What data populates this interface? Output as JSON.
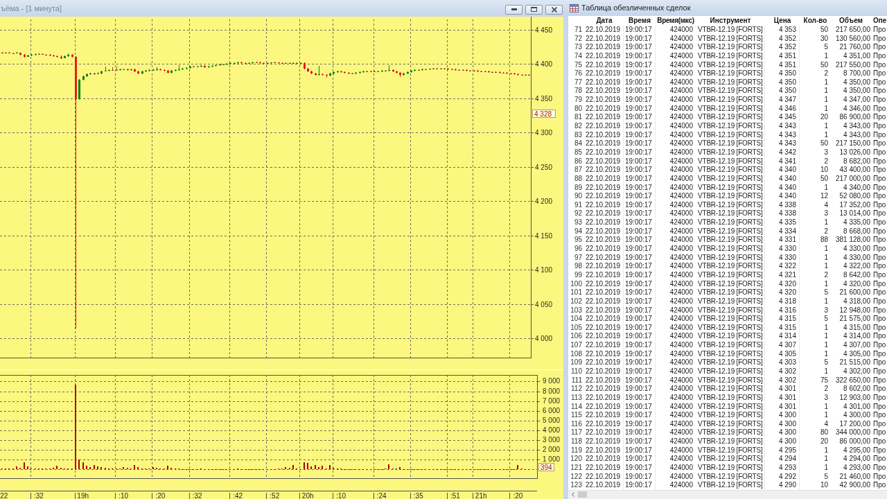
{
  "chart_window": {
    "title": "ъёма - [1 минута]",
    "price_chart": {
      "axis_labels": [
        "4 450",
        "4 400",
        "4 350",
        "4 300",
        "4 250",
        "4 200",
        "4 150",
        "4 100",
        "4 050",
        "4 000"
      ],
      "last_price": "4 328"
    },
    "volume_chart": {
      "chart_data": {
        "type": "bar",
        "grid": true,
        "categories": [
          "22",
          null,
          null,
          null,
          null,
          null,
          null,
          null,
          null,
          null,
          ":32",
          null,
          null,
          null,
          null,
          null,
          null,
          null,
          null,
          null,
          null,
          null,
          "19h",
          null,
          null,
          null,
          null,
          null,
          null,
          null,
          null,
          null,
          null,
          ":10",
          null,
          null,
          null,
          null,
          null,
          null,
          null,
          null,
          null,
          ":20",
          null,
          null,
          null,
          null,
          null,
          null,
          null,
          null,
          null,
          ":32",
          null,
          null,
          null,
          null,
          null,
          null,
          null,
          null,
          null,
          null,
          ":42",
          null,
          null,
          null,
          null,
          null,
          null,
          null,
          null,
          null,
          ":52",
          null,
          null,
          null,
          null,
          null,
          null,
          null,
          null,
          "20h",
          null,
          null,
          null,
          null,
          null,
          null,
          null,
          null,
          ":10",
          null,
          null,
          null,
          null,
          null,
          null,
          null,
          null,
          null,
          null,
          ":24",
          null,
          null,
          null,
          null,
          null,
          null,
          null,
          null,
          null,
          ":35",
          null,
          null,
          null,
          null,
          null,
          null,
          null,
          null,
          null,
          ":51",
          null,
          null,
          null,
          null,
          null,
          null,
          "21h",
          null,
          null,
          null,
          null,
          null,
          null,
          null,
          null,
          null,
          ":20",
          null,
          null,
          null
        ],
        "ylim": [
          -889,
          9673
        ],
        "yticks": [
          {
            "value": 9000,
            "label": "9 000"
          },
          {
            "value": 8000,
            "label": "8 000"
          },
          {
            "value": 7000,
            "label": "7 000"
          },
          {
            "value": 6000,
            "label": "6 000"
          },
          {
            "value": 5000,
            "label": "5 000"
          },
          {
            "value": 4000,
            "label": "4 000"
          },
          {
            "value": 3000,
            "label": "3 000"
          },
          {
            "value": 2000,
            "label": "2 000"
          },
          {
            "value": 1000,
            "label": "1 000"
          }
        ],
        "annotations": [
          {
            "text": "394",
            "y": 394
          }
        ],
        "values": [
          80,
          60,
          90,
          70,
          280,
          120,
          680,
          280,
          60,
          50,
          70,
          60,
          80,
          90,
          120,
          360,
          120,
          60,
          50,
          80,
          8700,
          1000,
          680,
          360,
          200,
          400,
          320,
          200,
          120,
          100,
          90,
          80,
          100,
          240,
          120,
          90,
          440,
          240,
          100,
          60,
          80,
          200,
          160,
          80,
          60,
          360,
          160,
          60,
          40,
          30,
          30,
          20,
          30,
          20,
          40,
          20,
          30,
          20,
          20,
          30,
          20,
          30,
          20,
          20,
          40,
          20,
          20,
          30,
          20,
          20,
          20,
          30,
          20,
          20,
          30,
          40,
          60,
          200,
          120,
          400,
          40,
          30,
          720,
          640,
          280,
          440,
          200,
          360,
          80,
          400,
          120,
          60,
          40,
          30,
          20,
          30,
          20,
          20,
          30,
          20,
          20,
          30,
          20,
          20,
          40,
          520,
          60,
          40,
          240,
          30,
          30,
          20,
          20,
          20,
          20,
          20,
          30,
          20,
          20,
          20,
          20,
          20,
          20,
          20,
          30,
          20,
          20,
          20,
          20,
          20,
          20,
          20,
          20,
          20,
          20,
          20,
          20,
          20,
          20,
          20,
          440,
          60,
          30,
          20
        ]
      }
    }
  },
  "trades_window": {
    "title": "Таблица обезличенных сделок",
    "table": {
      "columns": [
        "Дата",
        "Время",
        "Время(мкс)",
        "Инструмент",
        "Цена",
        "Кол-во",
        "Объем",
        "Опе"
      ],
      "rows": [
        {
          "number": "71",
          "cells": [
            "22.10.2019",
            "19:00:17",
            "424000",
            "VTBR-12.19 [FORTS]",
            "4 353",
            "50",
            "217 650,00",
            "Про"
          ]
        },
        {
          "number": "72",
          "cells": [
            "22.10.2019",
            "19:00:17",
            "424000",
            "VTBR-12.19 [FORTS]",
            "4 352",
            "30",
            "130 560,00",
            "Про"
          ]
        },
        {
          "number": "73",
          "cells": [
            "22.10.2019",
            "19:00:17",
            "424000",
            "VTBR-12.19 [FORTS]",
            "4 352",
            "5",
            "21 760,00",
            "Про"
          ]
        },
        {
          "number": "74",
          "cells": [
            "22.10.2019",
            "19:00:17",
            "424000",
            "VTBR-12.19 [FORTS]",
            "4 351",
            "1",
            "4 351,00",
            "Про"
          ]
        },
        {
          "number": "75",
          "cells": [
            "22.10.2019",
            "19:00:17",
            "424000",
            "VTBR-12.19 [FORTS]",
            "4 351",
            "50",
            "217 550,00",
            "Про"
          ]
        },
        {
          "number": "76",
          "cells": [
            "22.10.2019",
            "19:00:17",
            "424000",
            "VTBR-12.19 [FORTS]",
            "4 350",
            "2",
            "8 700,00",
            "Про"
          ]
        },
        {
          "number": "77",
          "cells": [
            "22.10.2019",
            "19:00:17",
            "424000",
            "VTBR-12.19 [FORTS]",
            "4 350",
            "1",
            "4 350,00",
            "Про"
          ]
        },
        {
          "number": "78",
          "cells": [
            "22.10.2019",
            "19:00:17",
            "424000",
            "VTBR-12.19 [FORTS]",
            "4 350",
            "1",
            "4 350,00",
            "Про"
          ]
        },
        {
          "number": "79",
          "cells": [
            "22.10.2019",
            "19:00:17",
            "424000",
            "VTBR-12.19 [FORTS]",
            "4 347",
            "1",
            "4 347,00",
            "Про"
          ]
        },
        {
          "number": "80",
          "cells": [
            "22.10.2019",
            "19:00:17",
            "424000",
            "VTBR-12.19 [FORTS]",
            "4 346",
            "1",
            "4 346,00",
            "Про"
          ]
        },
        {
          "number": "81",
          "cells": [
            "22.10.2019",
            "19:00:17",
            "424000",
            "VTBR-12.19 [FORTS]",
            "4 345",
            "20",
            "86 900,00",
            "Про"
          ]
        },
        {
          "number": "82",
          "cells": [
            "22.10.2019",
            "19:00:17",
            "424000",
            "VTBR-12.19 [FORTS]",
            "4 343",
            "1",
            "4 343,00",
            "Про"
          ]
        },
        {
          "number": "83",
          "cells": [
            "22.10.2019",
            "19:00:17",
            "424000",
            "VTBR-12.19 [FORTS]",
            "4 343",
            "1",
            "4 343,00",
            "Про"
          ]
        },
        {
          "number": "84",
          "cells": [
            "22.10.2019",
            "19:00:17",
            "424000",
            "VTBR-12.19 [FORTS]",
            "4 343",
            "50",
            "217 150,00",
            "Про"
          ]
        },
        {
          "number": "85",
          "cells": [
            "22.10.2019",
            "19:00:17",
            "424000",
            "VTBR-12.19 [FORTS]",
            "4 342",
            "3",
            "13 026,00",
            "Про"
          ]
        },
        {
          "number": "86",
          "cells": [
            "22.10.2019",
            "19:00:17",
            "424000",
            "VTBR-12.19 [FORTS]",
            "4 341",
            "2",
            "8 682,00",
            "Про"
          ]
        },
        {
          "number": "87",
          "cells": [
            "22.10.2019",
            "19:00:17",
            "424000",
            "VTBR-12.19 [FORTS]",
            "4 340",
            "10",
            "43 400,00",
            "Про"
          ]
        },
        {
          "number": "88",
          "cells": [
            "22.10.2019",
            "19:00:17",
            "424000",
            "VTBR-12.19 [FORTS]",
            "4 340",
            "50",
            "217 000,00",
            "Про"
          ]
        },
        {
          "number": "89",
          "cells": [
            "22.10.2019",
            "19:00:17",
            "424000",
            "VTBR-12.19 [FORTS]",
            "4 340",
            "1",
            "4 340,00",
            "Про"
          ]
        },
        {
          "number": "90",
          "cells": [
            "22.10.2019",
            "19:00:17",
            "424000",
            "VTBR-12.19 [FORTS]",
            "4 340",
            "12",
            "52 080,00",
            "Про"
          ]
        },
        {
          "number": "91",
          "cells": [
            "22.10.2019",
            "19:00:17",
            "424000",
            "VTBR-12.19 [FORTS]",
            "4 338",
            "4",
            "17 352,00",
            "Про"
          ]
        },
        {
          "number": "92",
          "cells": [
            "22.10.2019",
            "19:00:17",
            "424000",
            "VTBR-12.19 [FORTS]",
            "4 338",
            "3",
            "13 014,00",
            "Про"
          ]
        },
        {
          "number": "93",
          "cells": [
            "22.10.2019",
            "19:00:17",
            "424000",
            "VTBR-12.19 [FORTS]",
            "4 335",
            "1",
            "4 335,00",
            "Про"
          ]
        },
        {
          "number": "94",
          "cells": [
            "22.10.2019",
            "19:00:17",
            "424000",
            "VTBR-12.19 [FORTS]",
            "4 334",
            "2",
            "8 668,00",
            "Про"
          ]
        },
        {
          "number": "95",
          "cells": [
            "22.10.2019",
            "19:00:17",
            "424000",
            "VTBR-12.19 [FORTS]",
            "4 331",
            "88",
            "381 128,00",
            "Про"
          ]
        },
        {
          "number": "96",
          "cells": [
            "22.10.2019",
            "19:00:17",
            "424000",
            "VTBR-12.19 [FORTS]",
            "4 330",
            "1",
            "4 330,00",
            "Про"
          ]
        },
        {
          "number": "97",
          "cells": [
            "22.10.2019",
            "19:00:17",
            "424000",
            "VTBR-12.19 [FORTS]",
            "4 330",
            "1",
            "4 330,00",
            "Про"
          ]
        },
        {
          "number": "98",
          "cells": [
            "22.10.2019",
            "19:00:17",
            "424000",
            "VTBR-12.19 [FORTS]",
            "4 322",
            "1",
            "4 322,00",
            "Про"
          ]
        },
        {
          "number": "99",
          "cells": [
            "22.10.2019",
            "19:00:17",
            "424000",
            "VTBR-12.19 [FORTS]",
            "4 321",
            "2",
            "8 642,00",
            "Про"
          ]
        },
        {
          "number": "100",
          "cells": [
            "22.10.2019",
            "19:00:17",
            "424000",
            "VTBR-12.19 [FORTS]",
            "4 320",
            "1",
            "4 320,00",
            "Про"
          ]
        },
        {
          "number": "101",
          "cells": [
            "22.10.2019",
            "19:00:17",
            "424000",
            "VTBR-12.19 [FORTS]",
            "4 320",
            "5",
            "21 600,00",
            "Про"
          ]
        },
        {
          "number": "102",
          "cells": [
            "22.10.2019",
            "19:00:17",
            "424000",
            "VTBR-12.19 [FORTS]",
            "4 318",
            "1",
            "4 318,00",
            "Про"
          ]
        },
        {
          "number": "103",
          "cells": [
            "22.10.2019",
            "19:00:17",
            "424000",
            "VTBR-12.19 [FORTS]",
            "4 316",
            "3",
            "12 948,00",
            "Про"
          ]
        },
        {
          "number": "104",
          "cells": [
            "22.10.2019",
            "19:00:17",
            "424000",
            "VTBR-12.19 [FORTS]",
            "4 315",
            "5",
            "21 575,00",
            "Про"
          ]
        },
        {
          "number": "105",
          "cells": [
            "22.10.2019",
            "19:00:17",
            "424000",
            "VTBR-12.19 [FORTS]",
            "4 315",
            "1",
            "4 315,00",
            "Про"
          ]
        },
        {
          "number": "106",
          "cells": [
            "22.10.2019",
            "19:00:17",
            "424000",
            "VTBR-12.19 [FORTS]",
            "4 314",
            "1",
            "4 314,00",
            "Про"
          ]
        },
        {
          "number": "107",
          "cells": [
            "22.10.2019",
            "19:00:17",
            "424000",
            "VTBR-12.19 [FORTS]",
            "4 307",
            "1",
            "4 307,00",
            "Про"
          ]
        },
        {
          "number": "108",
          "cells": [
            "22.10.2019",
            "19:00:17",
            "424000",
            "VTBR-12.19 [FORTS]",
            "4 305",
            "1",
            "4 305,00",
            "Про"
          ]
        },
        {
          "number": "109",
          "cells": [
            "22.10.2019",
            "19:00:17",
            "424000",
            "VTBR-12.19 [FORTS]",
            "4 303",
            "5",
            "21 515,00",
            "Про"
          ]
        },
        {
          "number": "110",
          "cells": [
            "22.10.2019",
            "19:00:17",
            "424000",
            "VTBR-12.19 [FORTS]",
            "4 302",
            "1",
            "4 302,00",
            "Про"
          ]
        },
        {
          "number": "111",
          "cells": [
            "22.10.2019",
            "19:00:17",
            "424000",
            "VTBR-12.19 [FORTS]",
            "4 302",
            "75",
            "322 650,00",
            "Про"
          ]
        },
        {
          "number": "112",
          "cells": [
            "22.10.2019",
            "19:00:17",
            "424000",
            "VTBR-12.19 [FORTS]",
            "4 301",
            "2",
            "8 602,00",
            "Про"
          ]
        },
        {
          "number": "113",
          "cells": [
            "22.10.2019",
            "19:00:17",
            "424000",
            "VTBR-12.19 [FORTS]",
            "4 301",
            "3",
            "12 903,00",
            "Про"
          ]
        },
        {
          "number": "114",
          "cells": [
            "22.10.2019",
            "19:00:17",
            "424000",
            "VTBR-12.19 [FORTS]",
            "4 301",
            "1",
            "4 301,00",
            "Про"
          ]
        },
        {
          "number": "115",
          "cells": [
            "22.10.2019",
            "19:00:17",
            "424000",
            "VTBR-12.19 [FORTS]",
            "4 300",
            "1",
            "4 300,00",
            "Про"
          ]
        },
        {
          "number": "116",
          "cells": [
            "22.10.2019",
            "19:00:17",
            "424000",
            "VTBR-12.19 [FORTS]",
            "4 300",
            "4",
            "17 200,00",
            "Про"
          ]
        },
        {
          "number": "117",
          "cells": [
            "22.10.2019",
            "19:00:17",
            "424000",
            "VTBR-12.19 [FORTS]",
            "4 300",
            "80",
            "344 000,00",
            "Про"
          ]
        },
        {
          "number": "118",
          "cells": [
            "22.10.2019",
            "19:00:17",
            "424000",
            "VTBR-12.19 [FORTS]",
            "4 300",
            "20",
            "86 000,00",
            "Про"
          ]
        },
        {
          "number": "119",
          "cells": [
            "22.10.2019",
            "19:00:17",
            "424000",
            "VTBR-12.19 [FORTS]",
            "4 295",
            "1",
            "4 295,00",
            "Про"
          ]
        },
        {
          "number": "120",
          "cells": [
            "22.10.2019",
            "19:00:17",
            "424000",
            "VTBR-12.19 [FORTS]",
            "4 294",
            "1",
            "4 294,00",
            "Про"
          ]
        },
        {
          "number": "121",
          "cells": [
            "22.10.2019",
            "19:00:17",
            "424000",
            "VTBR-12.19 [FORTS]",
            "4 293",
            "1",
            "4 293,00",
            "Про"
          ]
        },
        {
          "number": "122",
          "cells": [
            "22.10.2019",
            "19:00:17",
            "424000",
            "VTBR-12.19 [FORTS]",
            "4 292",
            "5",
            "21 460,00",
            "Про"
          ]
        },
        {
          "number": "123",
          "cells": [
            "22.10.2019",
            "19:00:17",
            "424000",
            "VTBR-12.19 [FORTS]",
            "4 290",
            "10",
            "42 900,00",
            "Про"
          ]
        }
      ]
    }
  }
}
